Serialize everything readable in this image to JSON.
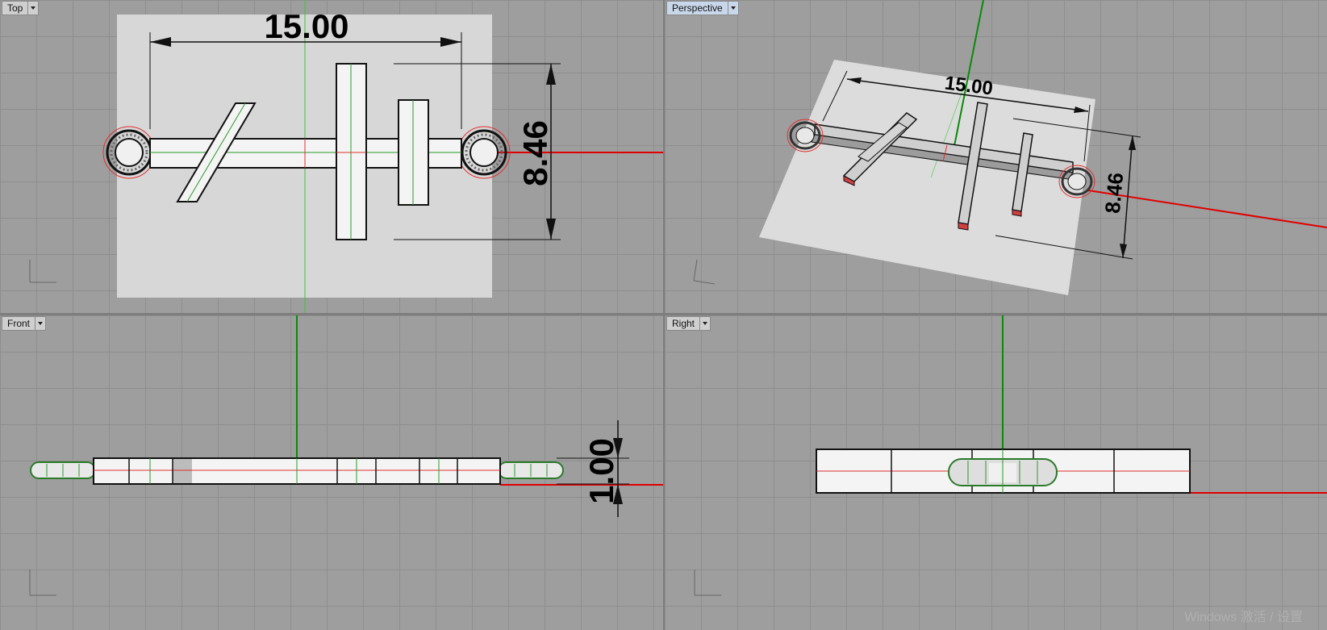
{
  "viewports": {
    "top": {
      "label": "Top"
    },
    "perspective": {
      "label": "Perspective"
    },
    "front": {
      "label": "Front"
    },
    "right": {
      "label": "Right"
    }
  },
  "dimensions": {
    "length": "15.00",
    "width": "8.46",
    "thickness": "1.00"
  },
  "watermark": "Windows 激活 / 设置",
  "colors": {
    "x_axis": "#e00000",
    "y_axis": "#008000",
    "grid": "#8e8e8e",
    "background": "#9e9e9e",
    "plane": "#d7d7d7"
  },
  "icons": [
    "dropdown-arrow-icon",
    "axis-indicator-icon"
  ]
}
